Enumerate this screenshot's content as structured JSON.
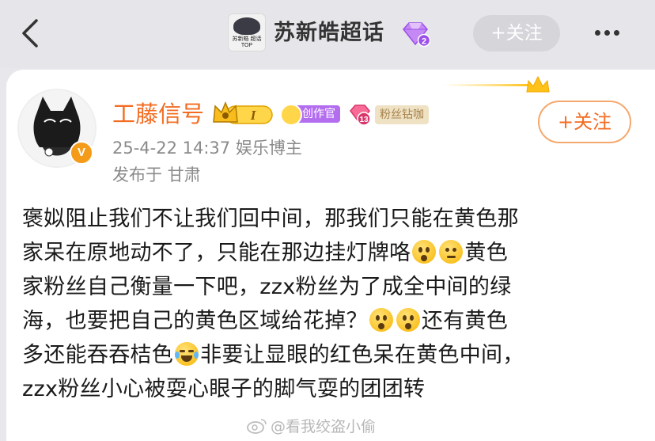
{
  "header": {
    "topic_name": "苏新皓超话",
    "thumb_caption": "苏新皓 超话TOP",
    "follow_label": "+关注",
    "icons": [
      "back-chevron-icon",
      "diamond-level-icon",
      "more-dots-icon"
    ]
  },
  "author": {
    "name": "工藤信号",
    "level_badge": "I",
    "creator_badge": "创作官",
    "fan_level": "13",
    "fan_tag": "粉丝钻咖",
    "verified_mark": "V",
    "time_and_role": "25-4-22 14:37  娱乐博主",
    "location": "发布于 甘肃",
    "follow_label": "+关注"
  },
  "post": {
    "lines": [
      "褒姒阻止我们不让我们回中间，那我们只能在黄色那",
      "家呆在原地动不了，只能在那边挂灯牌咯",
      "黄色",
      "家粉丝自己衡量一下吧，zzx粉丝为了成全中间的绿",
      "海，也要把自己的黄色区域给花掉？",
      "还有黄色",
      "多还能吞吞桔色",
      "非要让显眼的红色呆在黄色中间，",
      "zzx粉丝小心被耍心眼子的脚气耍的团团转"
    ]
  },
  "watermark": "@看我绞盗小偷",
  "colors": {
    "accent_orange": "#f36c21",
    "follow_border": "#f5a86e",
    "nav_bg": "#e6e6ea",
    "creator_purple": "#b36ef0",
    "fan_tag_bg": "#efe2c4"
  }
}
